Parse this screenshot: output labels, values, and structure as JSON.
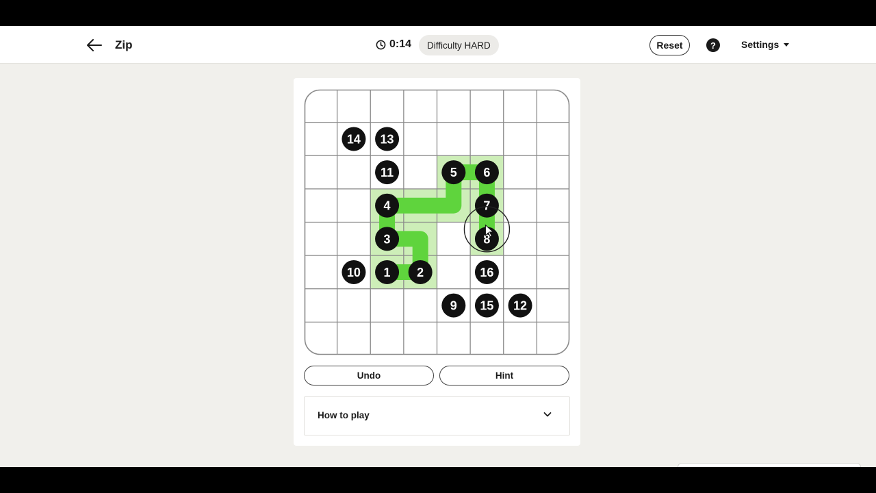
{
  "header": {
    "title": "Zip",
    "timer": "0:14",
    "difficulty": "Difficulty HARD",
    "reset_label": "Reset",
    "help_label": "?",
    "settings_label": "Settings"
  },
  "controls": {
    "undo_label": "Undo",
    "hint_label": "Hint",
    "how_to_play_label": "How to play"
  },
  "board": {
    "rows": 8,
    "cols": 8,
    "numbers": [
      {
        "label": "14",
        "row": 1,
        "col": 1
      },
      {
        "label": "13",
        "row": 1,
        "col": 2
      },
      {
        "label": "11",
        "row": 2,
        "col": 2
      },
      {
        "label": "5",
        "row": 2,
        "col": 4
      },
      {
        "label": "6",
        "row": 2,
        "col": 5
      },
      {
        "label": "4",
        "row": 3,
        "col": 2
      },
      {
        "label": "7",
        "row": 3,
        "col": 5
      },
      {
        "label": "3",
        "row": 4,
        "col": 2
      },
      {
        "label": "8",
        "row": 4,
        "col": 5
      },
      {
        "label": "10",
        "row": 5,
        "col": 1
      },
      {
        "label": "1",
        "row": 5,
        "col": 2
      },
      {
        "label": "2",
        "row": 5,
        "col": 3
      },
      {
        "label": "16",
        "row": 5,
        "col": 5
      },
      {
        "label": "9",
        "row": 6,
        "col": 4
      },
      {
        "label": "15",
        "row": 6,
        "col": 5
      },
      {
        "label": "12",
        "row": 6,
        "col": 6
      }
    ],
    "drawn_path": [
      [
        5,
        2
      ],
      [
        5,
        3
      ],
      [
        4,
        3
      ],
      [
        4,
        2
      ],
      [
        3,
        2
      ],
      [
        3,
        3
      ],
      [
        3,
        4
      ],
      [
        2,
        4
      ],
      [
        2,
        5
      ],
      [
        3,
        5
      ],
      [
        4,
        5
      ]
    ],
    "path_color": "#5fd43d",
    "visited_color": "#cdeeb8",
    "cursor_cell": [
      4,
      5
    ]
  }
}
